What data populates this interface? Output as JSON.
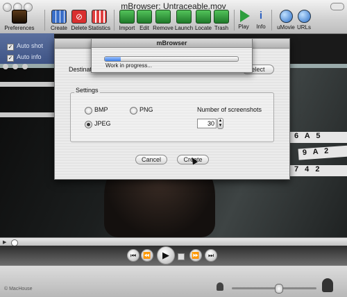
{
  "window": {
    "title": "mBrowser: Untraceable.mov"
  },
  "toolbar": {
    "preferences": "Preferences",
    "create": "Create",
    "delete": "Delete",
    "statistics": "Statistics",
    "import": "Import",
    "edit": "Edit",
    "remove": "Remove",
    "launch": "Launch",
    "locate": "Locate",
    "trash": "Trash",
    "play": "Play",
    "info": "Info",
    "umovie": "uMovie",
    "urls": "URLs"
  },
  "drawer": {
    "auto_shot": "Auto shot",
    "auto_info": "Auto info"
  },
  "dialog": {
    "destination_label": "Destinat",
    "select_button": "elect",
    "settings_label": "Settings",
    "format_bmp": "BMP",
    "format_png": "PNG",
    "format_jpeg": "JPEG",
    "selected_format": "JPEG",
    "screenshots_label": "Number of screenshots",
    "screenshots_value": "30",
    "cancel_button": "Cancel",
    "create_button": "Create"
  },
  "sheet": {
    "title": "mBrowser",
    "status": "Work in progress...",
    "progress": 0.12
  },
  "video": {
    "shelf_label_1": "6 A 5",
    "shelf_label_2": "9 A 2",
    "shelf_label_3": "7 4 2"
  },
  "status": {
    "copyright": "© MacHouse",
    "volume": 0.55
  },
  "colors": {
    "dialog_bg": "#ececec",
    "progress_blue": "#3d7ee6",
    "toolbar_green": "#2e9e3e"
  }
}
